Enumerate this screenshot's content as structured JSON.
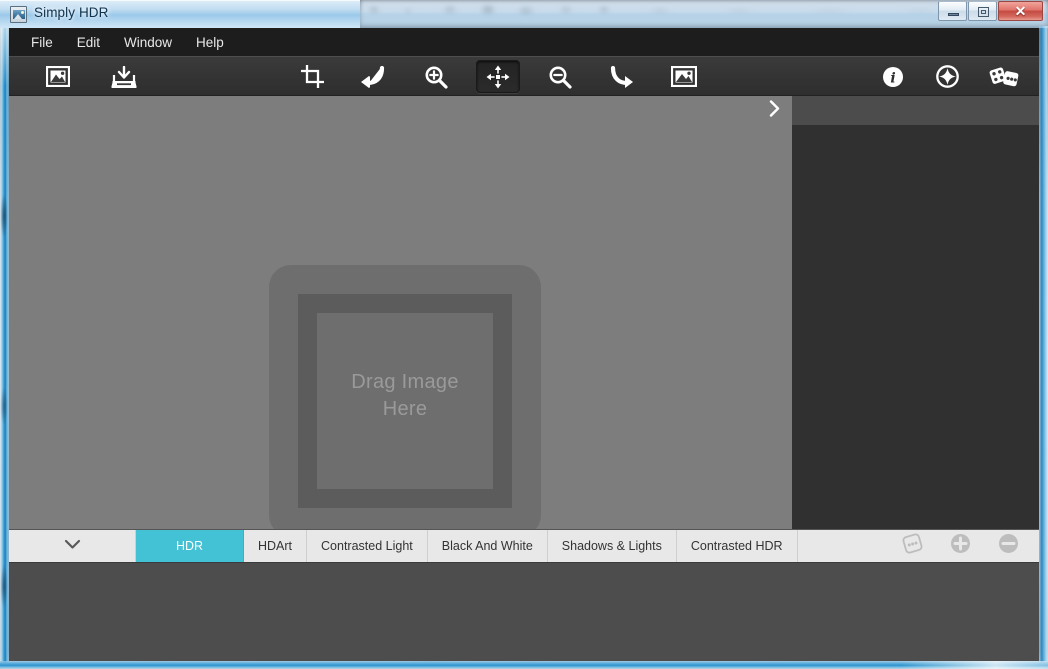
{
  "window": {
    "title": "Simply HDR",
    "app_icon": "picture-icon",
    "controls": {
      "minimize": "Minimize",
      "maximize": "Maximize",
      "close": "Close"
    }
  },
  "menubar": {
    "items": [
      {
        "label": "File"
      },
      {
        "label": "Edit"
      },
      {
        "label": "Window"
      },
      {
        "label": "Help"
      }
    ]
  },
  "toolbar": {
    "items": [
      {
        "name": "open-image-button",
        "icon": "image-frame-icon",
        "tooltip": "Open Image",
        "active": false
      },
      {
        "name": "save-image-button",
        "icon": "save-tray-icon",
        "tooltip": "Save Image",
        "active": false
      },
      {
        "name": "crop-button",
        "icon": "crop-icon",
        "tooltip": "Crop",
        "active": false
      },
      {
        "name": "undo-button",
        "icon": "undo-arrow-icon",
        "tooltip": "Undo",
        "active": false
      },
      {
        "name": "zoom-in-button",
        "icon": "magnifier-plus-icon",
        "tooltip": "Zoom In",
        "active": false
      },
      {
        "name": "pan-tool-button",
        "icon": "move-arrows-icon",
        "tooltip": "Pan",
        "active": true
      },
      {
        "name": "zoom-out-button",
        "icon": "magnifier-minus-icon",
        "tooltip": "Zoom Out",
        "active": false
      },
      {
        "name": "redo-button",
        "icon": "redo-arrow-icon",
        "tooltip": "Redo",
        "active": false
      },
      {
        "name": "fit-image-button",
        "icon": "image-frame-icon",
        "tooltip": "Fit Image",
        "active": false
      },
      {
        "name": "info-button",
        "icon": "info-circle-icon",
        "tooltip": "Information",
        "active": false
      },
      {
        "name": "effects-button",
        "icon": "sparkle-circle-icon",
        "tooltip": "Effects",
        "active": false
      },
      {
        "name": "randomize-button",
        "icon": "dice-icon",
        "tooltip": "Randomize",
        "active": false
      }
    ]
  },
  "canvas": {
    "dropzone": {
      "line1": "Drag Image",
      "line2": "Here"
    },
    "expand_icon": "chevron-right-icon"
  },
  "presets": {
    "dropdown_icon": "chevron-down-icon",
    "tabs": [
      {
        "label": "HDR",
        "active": true
      },
      {
        "label": "HDArt",
        "active": false
      },
      {
        "label": "Contrasted Light",
        "active": false
      },
      {
        "label": "Black And White",
        "active": false
      },
      {
        "label": "Shadows & Lights",
        "active": false
      },
      {
        "label": "Contrasted HDR",
        "active": false
      }
    ],
    "actions": [
      {
        "name": "random-preset-button",
        "icon": "dice-icon"
      },
      {
        "name": "add-preset-button",
        "icon": "plus-circle-icon"
      },
      {
        "name": "remove-preset-button",
        "icon": "minus-circle-icon"
      }
    ]
  },
  "colors": {
    "accent": "#42c2d4",
    "menubar_bg": "#1d1d1d",
    "toolbar_bg": "#353535",
    "canvas_bg": "#7d7d7d",
    "panel_bg": "#303030",
    "preset_bg": "#e8e8e8",
    "thumbstrip_bg": "#4d4d4d",
    "close_button": "#c44a41"
  }
}
